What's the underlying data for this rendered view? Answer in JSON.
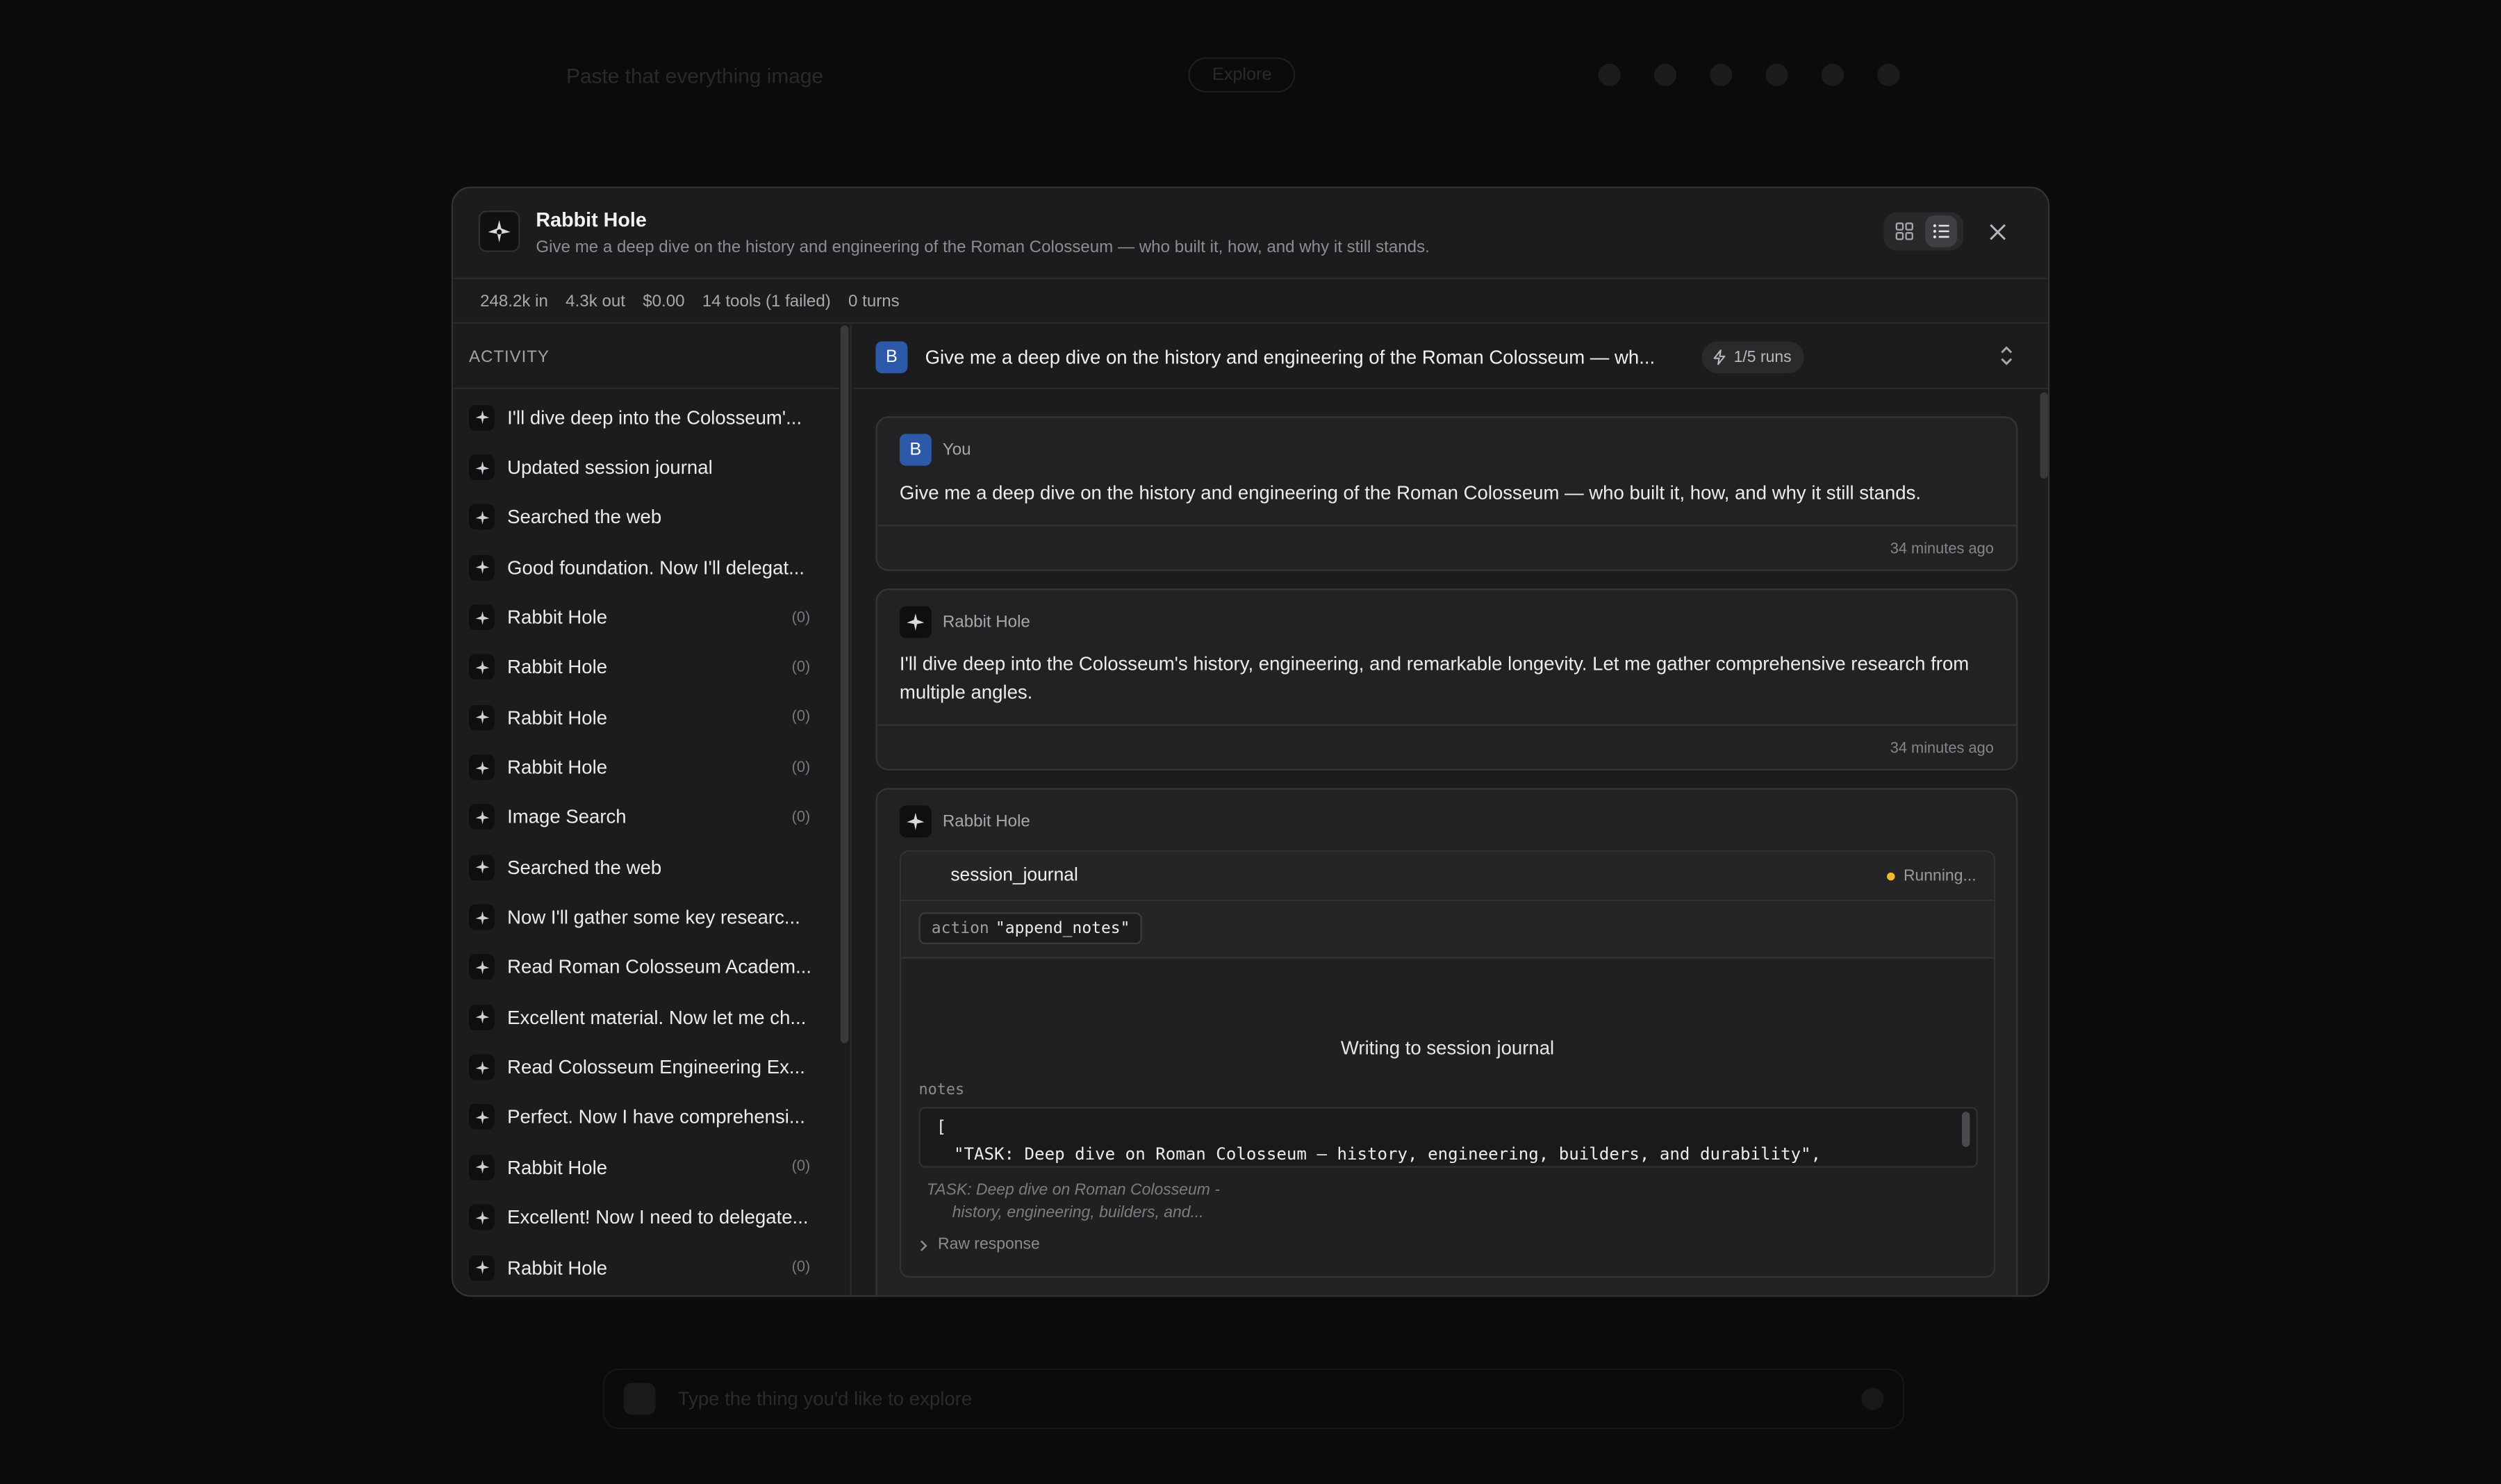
{
  "background": {
    "search_placeholder": "Paste that everything image",
    "pill_label": "Explore",
    "composer_placeholder": "Type the thing you'd like to explore"
  },
  "modal": {
    "app_title": "Rabbit Hole",
    "app_subtitle": "Give me a deep dive on the history and engineering of the Roman Colosseum — who built it, how, and why it still stands.",
    "stats": {
      "tokens_in": "248.2k in",
      "tokens_out": "4.3k out",
      "cost": "$0.00",
      "tools": "14 tools (1 failed)",
      "turns": "0 turns"
    }
  },
  "sidebar": {
    "heading": "ACTIVITY",
    "items": [
      {
        "label": "I'll dive deep into the Colosseum'...",
        "count": ""
      },
      {
        "label": "Updated session journal",
        "count": ""
      },
      {
        "label": "Searched the web",
        "count": ""
      },
      {
        "label": "Good foundation. Now I'll delegat...",
        "count": ""
      },
      {
        "label": "Rabbit Hole",
        "count": "(0)"
      },
      {
        "label": "Rabbit Hole",
        "count": "(0)"
      },
      {
        "label": "Rabbit Hole",
        "count": "(0)"
      },
      {
        "label": "Rabbit Hole",
        "count": "(0)"
      },
      {
        "label": "Image Search",
        "count": "(0)"
      },
      {
        "label": "Searched the web",
        "count": ""
      },
      {
        "label": "Now I'll gather some key researc...",
        "count": ""
      },
      {
        "label": "Read Roman Colosseum Academ...",
        "count": ""
      },
      {
        "label": "Excellent material. Now let me ch...",
        "count": ""
      },
      {
        "label": "Read Colosseum Engineering Ex...",
        "count": ""
      },
      {
        "label": "Perfect. Now I have comprehensi...",
        "count": ""
      },
      {
        "label": "Rabbit Hole",
        "count": "(0)"
      },
      {
        "label": "Excellent! Now I need to delegate...",
        "count": ""
      },
      {
        "label": "Rabbit Hole",
        "count": "(0)"
      }
    ]
  },
  "thread": {
    "avatar_letter": "B",
    "title": "Give me a deep dive on the history and engineering of the Roman Colosseum — wh...",
    "runs": "1/5 runs"
  },
  "messages": [
    {
      "author": "You",
      "avatar_letter": "B",
      "text": "Give me a deep dive on the history and engineering of the Roman Colosseum — who built it, how, and why it still stands.",
      "time": "34 minutes ago"
    },
    {
      "author": "Rabbit Hole",
      "text": "I'll dive deep into the Colosseum's history, engineering, and remarkable longevity. Let me gather comprehensive research from multiple angles.",
      "time": "34 minutes ago"
    },
    {
      "author": "Rabbit Hole",
      "tool": {
        "name": "session_journal",
        "status": "Running...",
        "status_color": "#f5b82e",
        "arg_key": "action",
        "arg_value": "\"append_notes\"",
        "message": "Writing to session journal",
        "notes_label": "notes",
        "code_line1": "[",
        "code_line2": "\"TASK: Deep dive on Roman Colosseum – history, engineering, builders, and durability\",",
        "summary_line1": "TASK: Deep dive on Roman Colosseum -",
        "summary_line2": "history, engineering, builders, and...",
        "raw_label": "Raw response"
      }
    }
  ],
  "colors": {
    "accent_avatar": "#2d5aa8",
    "running": "#f5b82e",
    "modal_bg": "#1c1c1e",
    "page_bg": "#0b0b0c"
  }
}
